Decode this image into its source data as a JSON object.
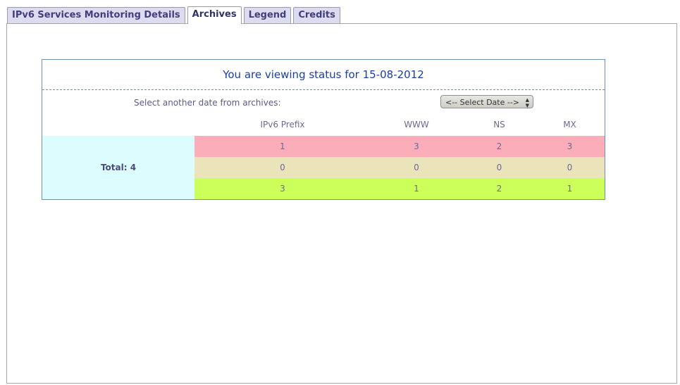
{
  "tabs": [
    {
      "label": "IPv6 Services Monitoring Details",
      "active": false
    },
    {
      "label": "Archives",
      "active": true
    },
    {
      "label": "Legend",
      "active": false
    },
    {
      "label": "Credits",
      "active": false
    }
  ],
  "status": {
    "title": "You are viewing status for 15-08-2012",
    "select_label": "Select another date from archives:",
    "select_value": "<-- Select Date -->"
  },
  "table": {
    "columns": [
      "IPv6 Prefix",
      "WWW",
      "NS",
      "MX"
    ],
    "total_label": "Total: 4",
    "rows": [
      {
        "status_color": "#fbadb9",
        "values": [
          "1",
          "3",
          "2",
          "3"
        ]
      },
      {
        "status_color": "#ebe4bb",
        "values": [
          "0",
          "0",
          "0",
          "0"
        ]
      },
      {
        "status_color": "#ccff5a",
        "values": [
          "3",
          "1",
          "2",
          "1"
        ]
      }
    ]
  },
  "colors": {
    "title_text": "#1a3fa0",
    "box_border": "#6e8fb6",
    "total_bg": "#ddfcfd"
  }
}
